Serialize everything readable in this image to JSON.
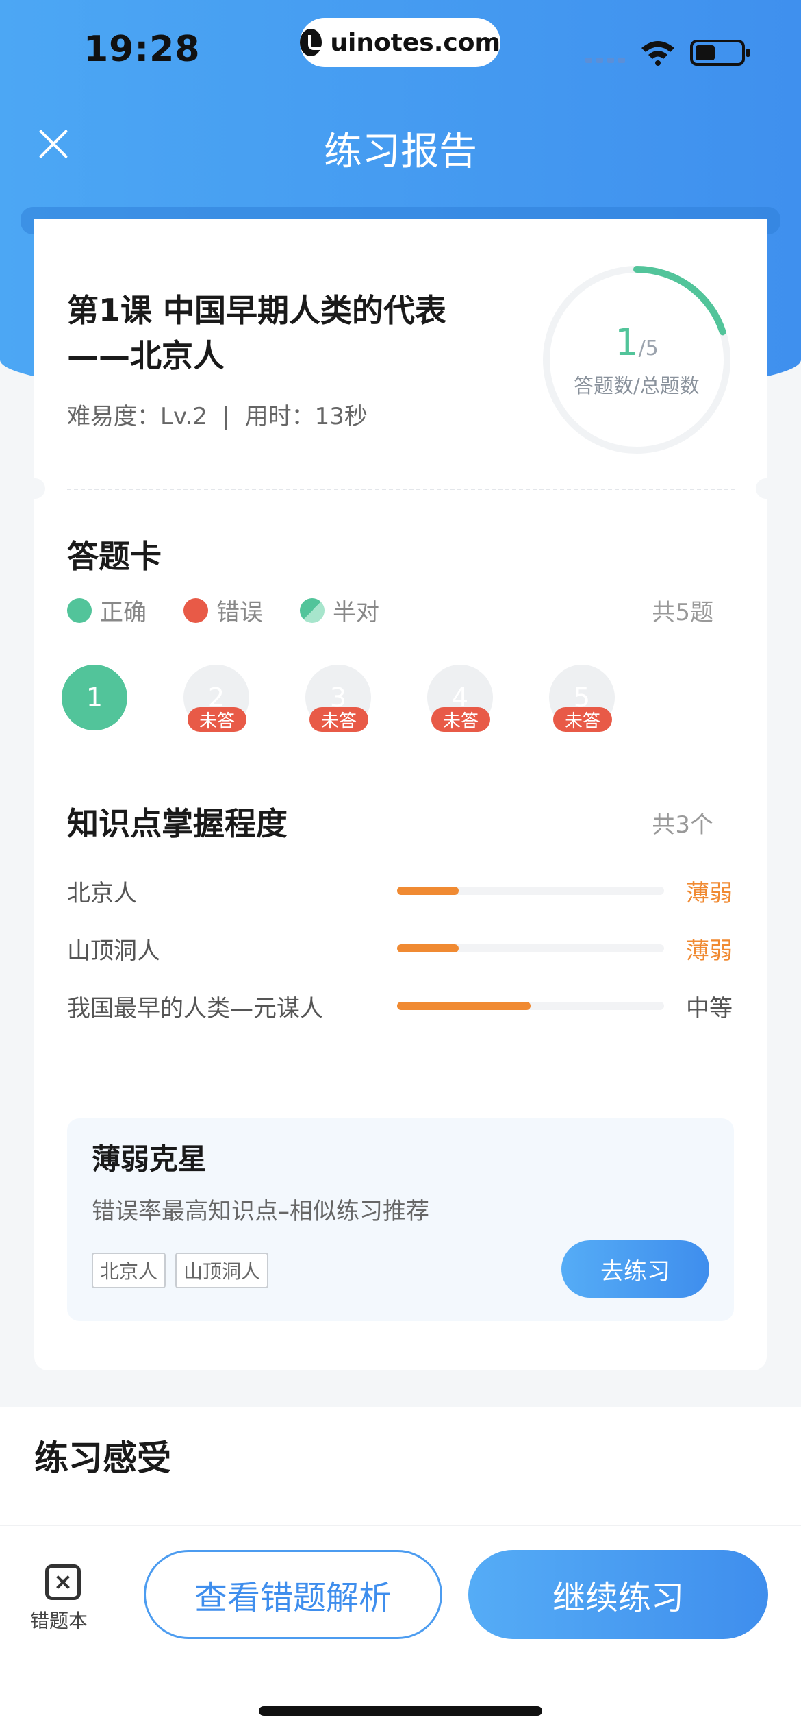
{
  "status_bar": {
    "time": "19:28",
    "url": "uinotes.com"
  },
  "nav": {
    "title": "练习报告"
  },
  "report": {
    "lesson_title": "第1课  中国早期人类的代表——北京人",
    "difficulty_label": "难易度：",
    "difficulty": "Lv.2",
    "separator": "|",
    "time_label": "用时：",
    "time_used": "13秒",
    "answered": "1",
    "total": "/5",
    "ring_label": "答题数/总题数",
    "progress_fraction": 0.2
  },
  "answer_card": {
    "title": "答题卡",
    "legend": [
      {
        "key": "correct",
        "label": "正确"
      },
      {
        "key": "wrong",
        "label": "错误"
      },
      {
        "key": "half",
        "label": "半对"
      }
    ],
    "count": "共5题",
    "questions": [
      {
        "number": "1",
        "status": "done",
        "tag": ""
      },
      {
        "number": "2",
        "status": "unanswered",
        "tag": "未答"
      },
      {
        "number": "3",
        "status": "unanswered",
        "tag": "未答"
      },
      {
        "number": "4",
        "status": "unanswered",
        "tag": "未答"
      },
      {
        "number": "5",
        "status": "unanswered",
        "tag": "未答"
      }
    ]
  },
  "knowledge": {
    "title": "知识点掌握程度",
    "count": "共3个",
    "points": [
      {
        "name": "北京人",
        "mastery": 0.23,
        "level": "薄弱",
        "level_color": "#F08A32"
      },
      {
        "name": "山顶洞人",
        "mastery": 0.23,
        "level": "薄弱",
        "level_color": "#F08A32"
      },
      {
        "name": "我国最早的人类—元谋人",
        "mastery": 0.5,
        "level": "中等",
        "level_color": "#555555"
      }
    ]
  },
  "weak": {
    "title": "薄弱克星",
    "desc": "错误率最高知识点–相似练习推荐",
    "chips": [
      "北京人",
      "山顶洞人"
    ],
    "button": "去练习"
  },
  "feeling": {
    "title": "练习感受"
  },
  "bottom": {
    "book_label": "错题本",
    "review_button": "查看错题解析",
    "continue_button": "继续练习"
  },
  "colors": {
    "accent": "#3F8EED",
    "correct": "#52C49A",
    "wrong": "#E85A47",
    "weak": "#F08A32"
  }
}
